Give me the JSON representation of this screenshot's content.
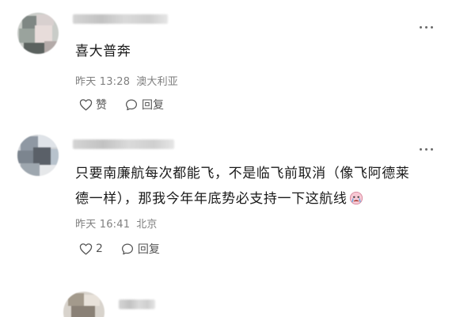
{
  "comments": [
    {
      "text_line1": "喜大普奔",
      "text_line2": "",
      "time": "昨天 13:28",
      "location": "澳大利亚",
      "like_label": "赞",
      "reply_label": "回复"
    },
    {
      "text_line1": "只要南廉航每次都能飞，不是临飞前取消（像飞阿德莱",
      "text_line2": "德一样），那我今年年底势必支持一下这航线",
      "time": "昨天 16:41",
      "location": "北京",
      "like_count": "2",
      "reply_label": "回复"
    }
  ],
  "icons": {
    "more": "more-dots-icon",
    "like": "heart-icon",
    "reply": "reply-bubble-icon",
    "emoji": "crying-face-emoji"
  },
  "colors": {
    "text": "#1a1a1a",
    "meta": "#808080",
    "action": "#555555"
  }
}
